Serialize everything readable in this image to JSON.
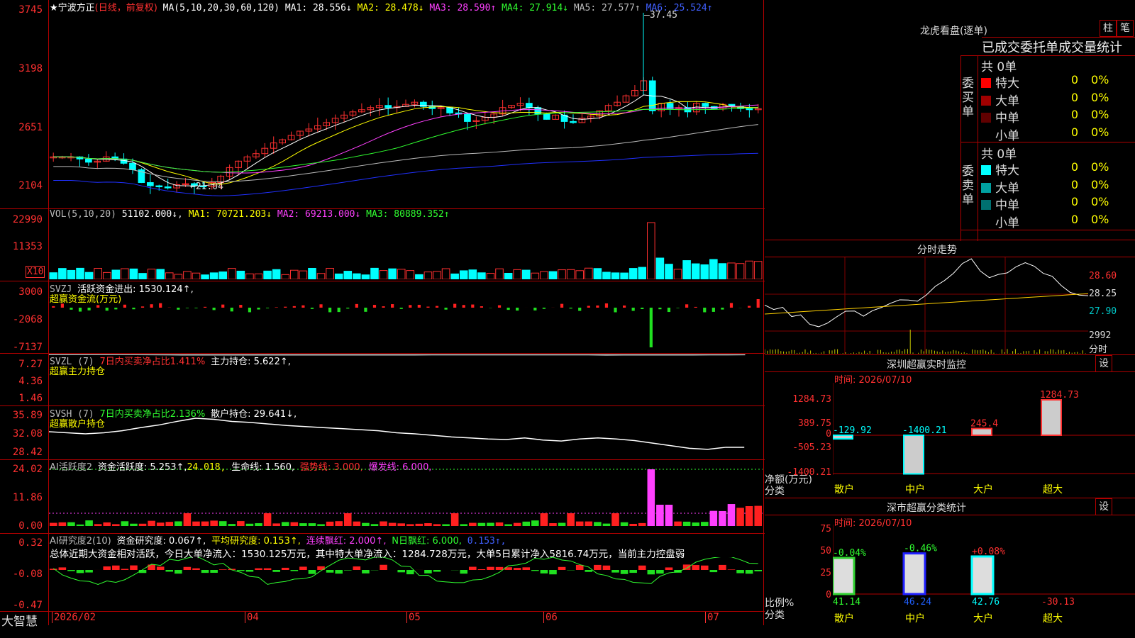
{
  "main": {
    "title": "★宁波方正",
    "mode": "(日线，前复权)",
    "ma_label": "MA(5,10,20,30,60,120)",
    "ma": [
      {
        "label": "MA1:",
        "value": "28.556↓",
        "color": "#ffffff"
      },
      {
        "label": "MA2:",
        "value": "28.478↓",
        "color": "#ffff00"
      },
      {
        "label": "MA3:",
        "value": "28.590↑",
        "color": "#ff40ff"
      },
      {
        "label": "MA4:",
        "value": "27.914↓",
        "color": "#30ff30"
      },
      {
        "label": "MA5:",
        "value": "27.577↑",
        "color": "#bbbbbb"
      },
      {
        "label": "MA6:",
        "value": "25.524↑",
        "color": "#4060ff"
      }
    ],
    "y_ticks": [
      "3745",
      "3198",
      "2651",
      "2104"
    ],
    "high_marker": "37.45",
    "low_marker": "21.04"
  },
  "vol": {
    "label": "VOL(5,10,20)",
    "value": "51102.000↓",
    "ma": [
      {
        "label": "MA1:",
        "value": "70721.203↓",
        "color": "#ffff00"
      },
      {
        "label": "MA2:",
        "value": "69213.000↓",
        "color": "#ff40ff"
      },
      {
        "label": "MA3:",
        "value": "80889.352↑",
        "color": "#30ff30"
      }
    ],
    "y_ticks": [
      "22990",
      "11353",
      "X10"
    ]
  },
  "svzj": {
    "label": "SVZJ",
    "desc": "活跃资金进出: 1530.124↑,",
    "sub": "超赢资金流(万元)",
    "y_ticks": [
      "3000",
      "-2068",
      "-7137"
    ]
  },
  "svzl": {
    "label": "SVZL (7)",
    "desc1": "7日内买卖净占比1.411%",
    "desc2": "主力持仓: 5.622↑,",
    "sub": "超赢主力持仓",
    "y_ticks": [
      "7.27",
      "4.36",
      "1.46"
    ]
  },
  "svsh": {
    "label": "SVSH (7)",
    "desc1": "7日内买卖净占比2.136%",
    "desc2": "散户持仓: 29.641↓,",
    "sub": "超赢散户持仓",
    "y_ticks": [
      "35.89",
      "32.08",
      "28.42"
    ]
  },
  "ai_active": {
    "label": "AI活跃度2",
    "d1": "资金活跃度: 5.253↑,",
    "d2": "24.018,",
    "d3": "生命线: 1.560,",
    "d4": "强势线: 3.000,",
    "d5": "爆发线: 6.000,",
    "y_ticks": [
      "24.02",
      "11.86",
      "0.00"
    ]
  },
  "ai_research": {
    "label": "AI研究度2(10)",
    "d1": "资金研究度: 0.067↑,",
    "d2": "平均研究度: 0.153↑,",
    "d3": "连续飘红: 2.000↑,",
    "d4": "N日飘红: 6.000,",
    "d5": "0.153↑,",
    "summary": "总体近期大资金相对活跃，今日大单净流入：1530.125万元，其中特大单净流入：1284.728万元，大单5日累计净入5816.74万元，当前主力控盘弱",
    "y_ticks": [
      "0.32",
      "-0.08",
      "-0.47"
    ]
  },
  "footer": {
    "brand": "大智慧",
    "dates": [
      "2026/02",
      "04",
      "05",
      "06",
      "07"
    ]
  },
  "right": {
    "lhb_title": "龙虎看盘(逐单)",
    "btn_zhu": "柱",
    "btn_bi": "笔",
    "table_title": "已成交委托单成交量统计",
    "buy_side": "委买单",
    "sell_side": "委卖单",
    "buy_total": "共 0单",
    "sell_total": "共 0单",
    "buy_rows": [
      {
        "label": "特大",
        "count": "0",
        "pct": "0%",
        "color": "#ff0000"
      },
      {
        "label": "大单",
        "count": "0",
        "pct": "0%",
        "color": "#a00000"
      },
      {
        "label": "中单",
        "count": "0",
        "pct": "0%",
        "color": "#600000"
      },
      {
        "label": "小单",
        "count": "0",
        "pct": "0%",
        "color": ""
      }
    ],
    "sell_rows": [
      {
        "label": "特大",
        "count": "0",
        "pct": "0%",
        "color": "#00ffff"
      },
      {
        "label": "大单",
        "count": "0",
        "pct": "0%",
        "color": "#00a0a0"
      },
      {
        "label": "中单",
        "count": "0",
        "pct": "0%",
        "color": "#007070"
      },
      {
        "label": "小单",
        "count": "0",
        "pct": "0%",
        "color": ""
      }
    ],
    "fenshi_title": "分时走势",
    "fenshi_y": [
      "28.60",
      "28.25",
      "27.90"
    ],
    "fenshi_vol": "2992",
    "fenshi_vol_unit": "分时",
    "monitor_title": "深圳超赢实时监控",
    "monitor_btn": "设",
    "monitor_time": "时间: 2026/07/10",
    "monitor_y": [
      "1284.73",
      "389.75",
      "0",
      "-505.23",
      "-1400.21"
    ],
    "monitor_axis_title": "净额(万元)",
    "monitor_cat_title": "分类",
    "monitor_cats": [
      "散户",
      "中户",
      "大户",
      "超大"
    ],
    "monitor_values": [
      "-129.92",
      "-1400.21",
      "245.4",
      "1284.73"
    ],
    "stat_title": "深市超赢分类统计",
    "stat_btn": "设",
    "stat_time": "时间: 2026/07/10",
    "stat_y": [
      "75",
      "50",
      "25",
      "0"
    ],
    "stat_axis_title": "比例%",
    "stat_cat_title": "分类",
    "stat_cats": [
      "散户",
      "中户",
      "大户",
      "超大"
    ],
    "stat_top": [
      "-0.04%",
      "-0.46%",
      "+0.08%",
      ""
    ],
    "stat_bottom": [
      "41.14",
      "46.24",
      "42.76",
      "-30.13"
    ]
  }
}
